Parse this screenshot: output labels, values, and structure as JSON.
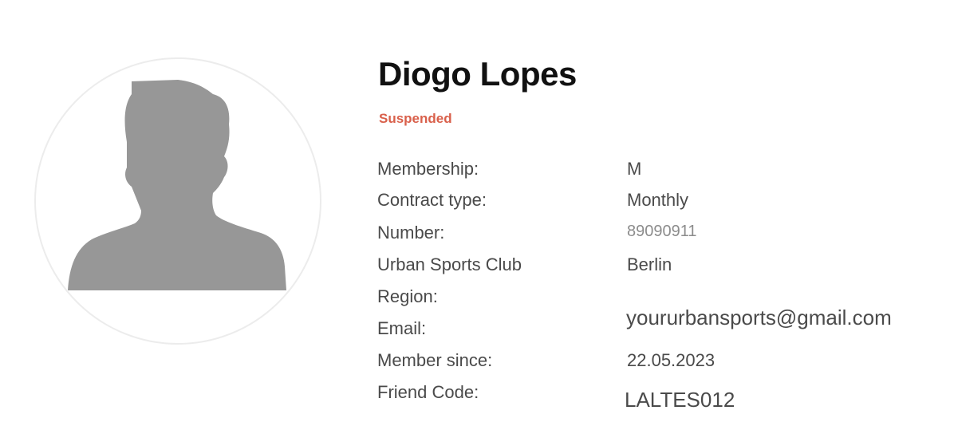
{
  "profile": {
    "name": "Diogo Lopes",
    "status": "Suspended",
    "status_color": "#d9604b",
    "avatar_icon": "person-silhouette-icon"
  },
  "details": {
    "membership_label": "Membership:",
    "membership_value": "M",
    "contract_label": "Contract type:",
    "contract_value": "Monthly",
    "number_label": "Number:",
    "number_value": "89090911",
    "region_label_line1": "Urban Sports Club",
    "region_label_line2": "Region:",
    "region_value": "Berlin",
    "email_label": "Email:",
    "email_value": "yoururbansports@gmail.com",
    "member_since_label": "Member since:",
    "member_since_value": "22.05.2023",
    "friend_code_label": "Friend Code:",
    "friend_code_value": "LALTES012"
  }
}
